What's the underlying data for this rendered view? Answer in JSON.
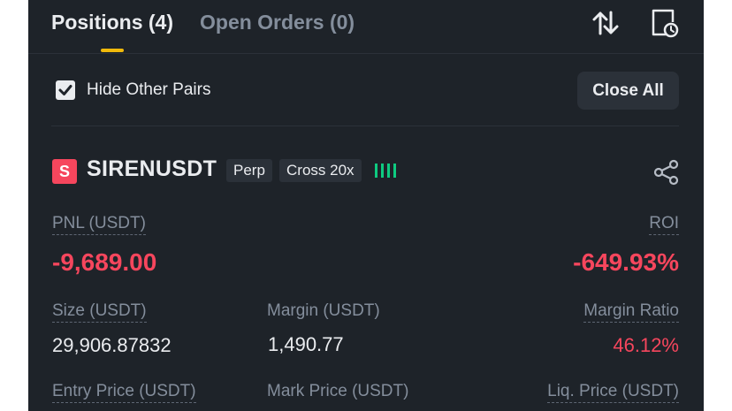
{
  "tabs": {
    "positions": "Positions (4)",
    "open_orders": "Open Orders (0)"
  },
  "filter": {
    "hide_other_pairs": "Hide Other Pairs",
    "hide_other_pairs_checked": true,
    "close_all": "Close All"
  },
  "position": {
    "side_badge": "S",
    "symbol": "SIRENUSDT",
    "contract_tag": "Perp",
    "margin_tag": "Cross 20x",
    "pnl_label": "PNL (USDT)",
    "pnl_value": "-9,689.00",
    "roi_label": "ROI",
    "roi_value": "-649.93%",
    "size_label": "Size (USDT)",
    "size_value": "29,906.87832",
    "margin_label": "Margin (USDT)",
    "margin_value": "1,490.77",
    "margin_ratio_label": "Margin Ratio",
    "margin_ratio_value": "46.12%",
    "entry_price_label": "Entry Price (USDT)",
    "mark_price_label": "Mark Price (USDT)",
    "liq_price_label": "Liq. Price (USDT)"
  },
  "icons": {
    "sort": "sort-arrows-icon",
    "history": "document-clock-icon",
    "share": "share-icon",
    "signal": "signal-bars-icon",
    "check": "check-icon"
  },
  "colors": {
    "background": "#1e2329",
    "accent": "#f0b90b",
    "negative": "#f6465d",
    "positive": "#0ecb81",
    "text_primary": "#eaecef",
    "text_secondary": "#848e9c"
  }
}
